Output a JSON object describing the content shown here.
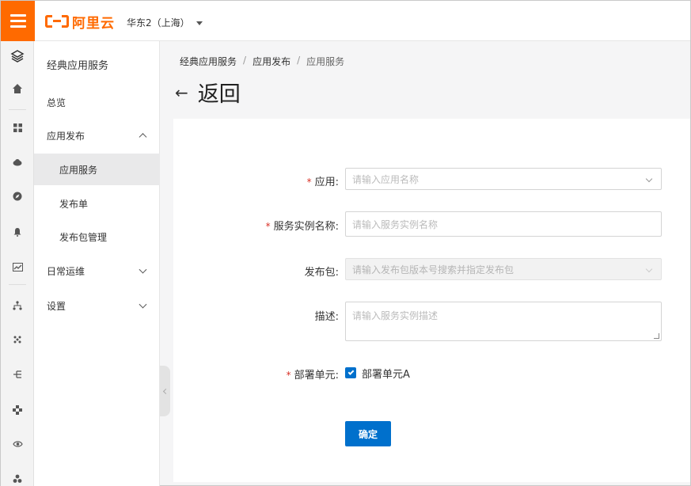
{
  "header": {
    "logo_text": "阿里云",
    "region": "华东2（上海）"
  },
  "rail": {
    "icons": [
      "layers-icon",
      "home-icon",
      "grid-icon",
      "cloud-icon",
      "compass-icon",
      "bell-icon",
      "chart-icon",
      "tree-icon",
      "dots-icon",
      "branch-icon",
      "nodes-icon",
      "eye-icon",
      "cluster-icon"
    ]
  },
  "nav": {
    "title": "经典应用服务",
    "overview": "总览",
    "app_release": "应用发布",
    "app_service": "应用服务",
    "release_order": "发布单",
    "package_mgmt": "发布包管理",
    "daily_ops": "日常运维",
    "settings": "设置"
  },
  "breadcrumb": {
    "items": [
      "经典应用服务",
      "应用发布",
      "应用服务"
    ],
    "separator": "/"
  },
  "page": {
    "back_arrow": "←",
    "back_title": "返回"
  },
  "form": {
    "required_mark": "*",
    "app_label": "应用:",
    "app_placeholder": "请输入应用名称",
    "instance_label": "服务实例名称:",
    "instance_placeholder": "请输入服务实例名称",
    "package_label": "发布包:",
    "package_placeholder": "请输入发布包版本号搜索并指定发布包",
    "desc_label": "描述:",
    "desc_placeholder": "请输入服务实例描述",
    "unit_label": "部署单元:",
    "unit_option": "部署单元A",
    "unit_checked": true,
    "submit": "确定"
  },
  "colors": {
    "brand": "#ff6a00",
    "primary": "#0070cc",
    "required": "#d93026"
  }
}
